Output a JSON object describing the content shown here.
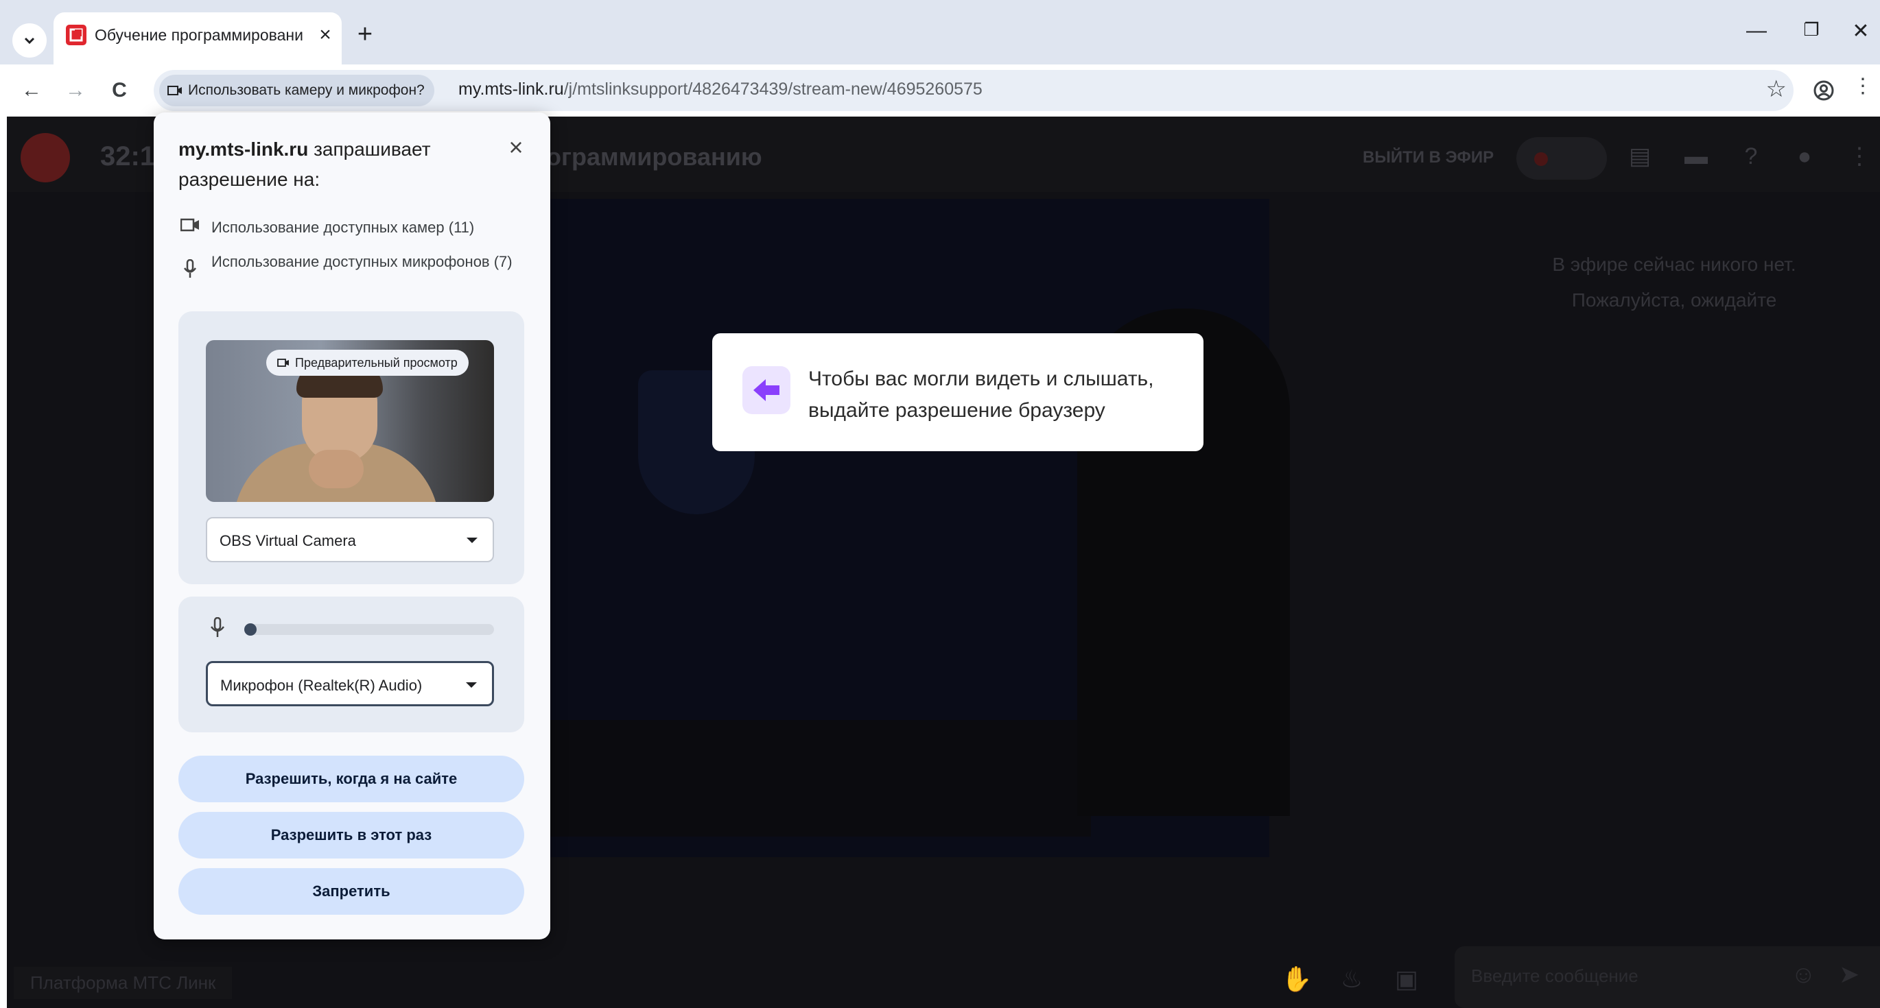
{
  "browser": {
    "tab": {
      "title": "Обучение программировани",
      "favicon": "mts-link-favicon",
      "accent": "#e0262e"
    },
    "window_controls": {
      "minimize": "—",
      "restore": "❐",
      "close": "✕"
    },
    "nav": {
      "back": "←",
      "forward": "→",
      "reload": "C"
    },
    "permission_chip": "Использовать камеру и микрофон?",
    "url_host": "my.mts-link.ru",
    "url_path": "/j/mtslinksupport/4826473439/stream-new/4695260575"
  },
  "page": {
    "timer": "32:1",
    "stream_title": "ограммированию",
    "go_live": "ВЫЙТИ В ЭФИР",
    "empty_line1": "В эфире сейчас никого нет.",
    "empty_line2": "Пожалуйста, ожидайте",
    "footer_label": "Платформа МТС Линк",
    "message_placeholder": "Введите сообщение",
    "hint_line1": "Чтобы вас могли видеть и слышать,",
    "hint_line2": "выдайте разрешение браузеру",
    "hint_icon_color": "#8a3ffc"
  },
  "prompt": {
    "site": "my.mts-link.ru",
    "title_rest": "запрашивает разрешение на:",
    "camera_perm": "Использование доступных камер (11)",
    "mic_perm": "Использование доступных микрофонов (7)",
    "preview_label": "Предварительный просмотр",
    "camera_select": "OBS Virtual Camera",
    "mic_select": "Микрофон (Realtek(R) Audio)",
    "mic_level": 0.0,
    "allow_on_site": "Разрешить, когда я на сайте",
    "allow_once": "Разрешить в этот раз",
    "deny": "Запретить",
    "button_color": "#d3e3fd"
  }
}
